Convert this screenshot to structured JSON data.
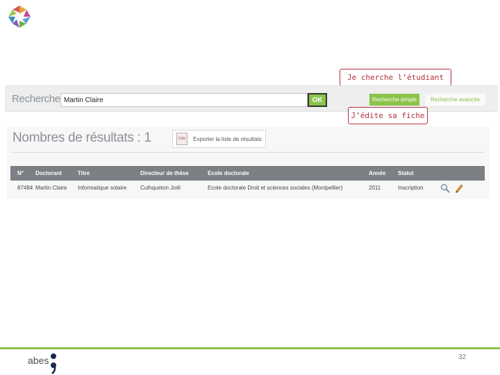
{
  "callouts": {
    "search": "Je cherche l’étudiant",
    "edit": "J’édite sa fiche"
  },
  "search": {
    "label": "Rechercher",
    "value": "Martin Claire",
    "ok_label": "OK",
    "simple_label": "Recherche simple",
    "advanced_label": "Recherche avancée"
  },
  "results": {
    "count_label": "Nombres de résultats : 1",
    "export_label": "Exporter la liste de résultats",
    "csv_icon_text": "CSV"
  },
  "table": {
    "headers": {
      "num": "N°",
      "doctorant": "Doctorant",
      "titre": "Titre",
      "directeur": "Directeur de thèse",
      "ecole": "Ecole doctorale",
      "annee": "Année",
      "statut": "Statut"
    },
    "rows": [
      {
        "num": "87484",
        "doctorant": "Martin Claire",
        "titre": "Informatique solaire",
        "directeur": "Culhqueton Joël",
        "ecole": "Ecole doctorale Droit et sciences sociales (Montpellier)",
        "annee": "2011",
        "statut": "Inscription"
      }
    ]
  },
  "footer": {
    "brand": "abes",
    "page_number": "32"
  },
  "colors": {
    "accent_green": "#8bc34a",
    "callout_red": "#b0303a",
    "header_gray": "#7c7f84"
  },
  "icons": {
    "view": "magnifier-icon",
    "edit": "pencil-icon"
  }
}
